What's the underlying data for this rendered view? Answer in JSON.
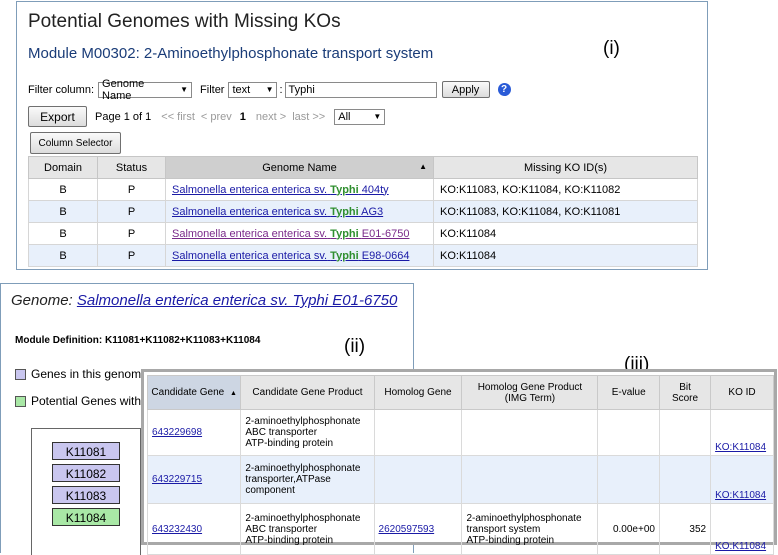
{
  "panel1": {
    "title": "Potential Genomes with Missing KOs",
    "module": "Module M00302: 2-Aminoethylphosphonate transport system",
    "label": "(i)",
    "filter": {
      "column_label": "Filter column:",
      "column_value": "Genome Name",
      "filter_label": "Filter",
      "type_value": "text",
      "colon": ":",
      "query": "Typhi",
      "apply_label": "Apply",
      "help": "?"
    },
    "export_label": "Export",
    "pagination": {
      "page_text": "Page 1 of 1",
      "first": "<< first",
      "prev": "< prev",
      "current": "1",
      "next": "next >",
      "last": "last >>",
      "per_page": "All"
    },
    "column_selector_label": "Column Selector",
    "table": {
      "headers": [
        "Domain",
        "Status",
        "Genome Name",
        "Missing KO ID(s)"
      ],
      "rows": [
        {
          "domain": "B",
          "status": "P",
          "name_prefix": "Salmonella enterica enterica sv.",
          "name_bold": "Typhi",
          "name_suffix": "404ty",
          "kos": "KO:K11083, KO:K11084, KO:K11082"
        },
        {
          "domain": "B",
          "status": "P",
          "name_prefix": "Salmonella enterica enterica sv.",
          "name_bold": "Typhi",
          "name_suffix": "AG3",
          "kos": "KO:K11083, KO:K11084, KO:K11081"
        },
        {
          "domain": "B",
          "status": "P",
          "name_prefix": "Salmonella enterica enterica sv.",
          "name_bold": "Typhi",
          "name_suffix": "E01-6750",
          "kos": "KO:K11084"
        },
        {
          "domain": "B",
          "status": "P",
          "name_prefix": "Salmonella enterica enterica sv.",
          "name_bold": "Typhi",
          "name_suffix": "E98-0664",
          "kos": "KO:K11084"
        }
      ]
    }
  },
  "panel2": {
    "genome_label": "Genome:",
    "genome_name": "Salmonella enterica enterica sv. Typhi E01-6750",
    "module_def": "Module Definition: K11081+K11082+K11083+K11084",
    "label": "(ii)",
    "legend1": "Genes in this genom",
    "legend2": "Potential Genes with K",
    "kos": [
      "K11081",
      "K11082",
      "K11083",
      "K11084"
    ],
    "colors": {
      "present": "#c9c6ef",
      "potential": "#a9e8a6"
    }
  },
  "panel3": {
    "label": "(iii)",
    "headers": {
      "candidate_gene": "Candidate Gene",
      "candidate_product": "Candidate Gene Product",
      "homolog_gene": "Homolog Gene",
      "homolog_product_1": "Homolog Gene Product",
      "homolog_product_2": "(IMG Term)",
      "evalue": "E-value",
      "bit_score_1": "Bit",
      "bit_score_2": "Score",
      "ko_id": "KO ID"
    },
    "rows": [
      {
        "gene": "643229698",
        "product": [
          "2-aminoethylphosphonate",
          "ABC transporter",
          "ATP-binding protein"
        ],
        "homolog": "",
        "homolog_product": [
          "",
          "",
          ""
        ],
        "evalue": "",
        "bit": "",
        "ko": "KO:K11084"
      },
      {
        "gene": "643229715",
        "product": [
          "2-aminoethylphosphonate",
          "transporter,ATPase",
          "component"
        ],
        "homolog": "",
        "homolog_product": [
          "",
          "",
          ""
        ],
        "evalue": "",
        "bit": "",
        "ko": "KO:K11084"
      },
      {
        "gene": "643232430",
        "product": [
          "2-aminoethylphosphonate",
          "ABC transporter",
          "ATP-binding protein"
        ],
        "homolog": "2620597593",
        "homolog_product": [
          "2-aminoethylphosphonate",
          "transport system",
          "ATP-binding protein"
        ],
        "evalue": "0.00e+00",
        "bit": "352",
        "ko": "KO:K11084"
      }
    ]
  }
}
